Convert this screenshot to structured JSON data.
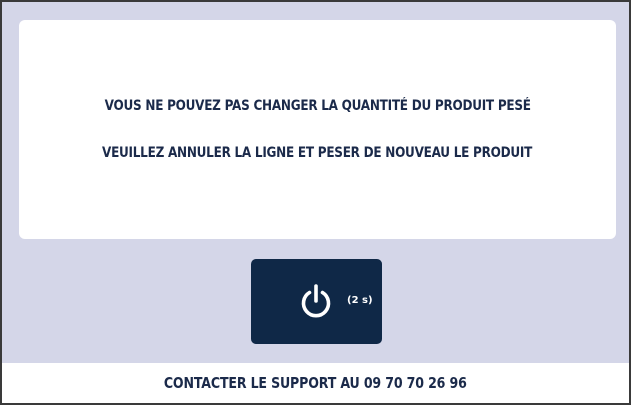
{
  "message": {
    "line1": "VOUS NE POUVEZ PAS CHANGER LA QUANTITÉ DU PRODUIT PESÉ",
    "line2": "VEUILLEZ ANNULER LA LIGNE ET PESER DE NOUVEAU LE PRODUIT"
  },
  "power_button": {
    "icon": "power-icon",
    "countdown": "(2 s)"
  },
  "footer": {
    "support_text": "CONTACTER LE SUPPORT AU 09 70 70 26 96"
  },
  "colors": {
    "background": "#d4d6e8",
    "card": "#ffffff",
    "button": "#0f2847",
    "text": "#1b2a4a"
  }
}
